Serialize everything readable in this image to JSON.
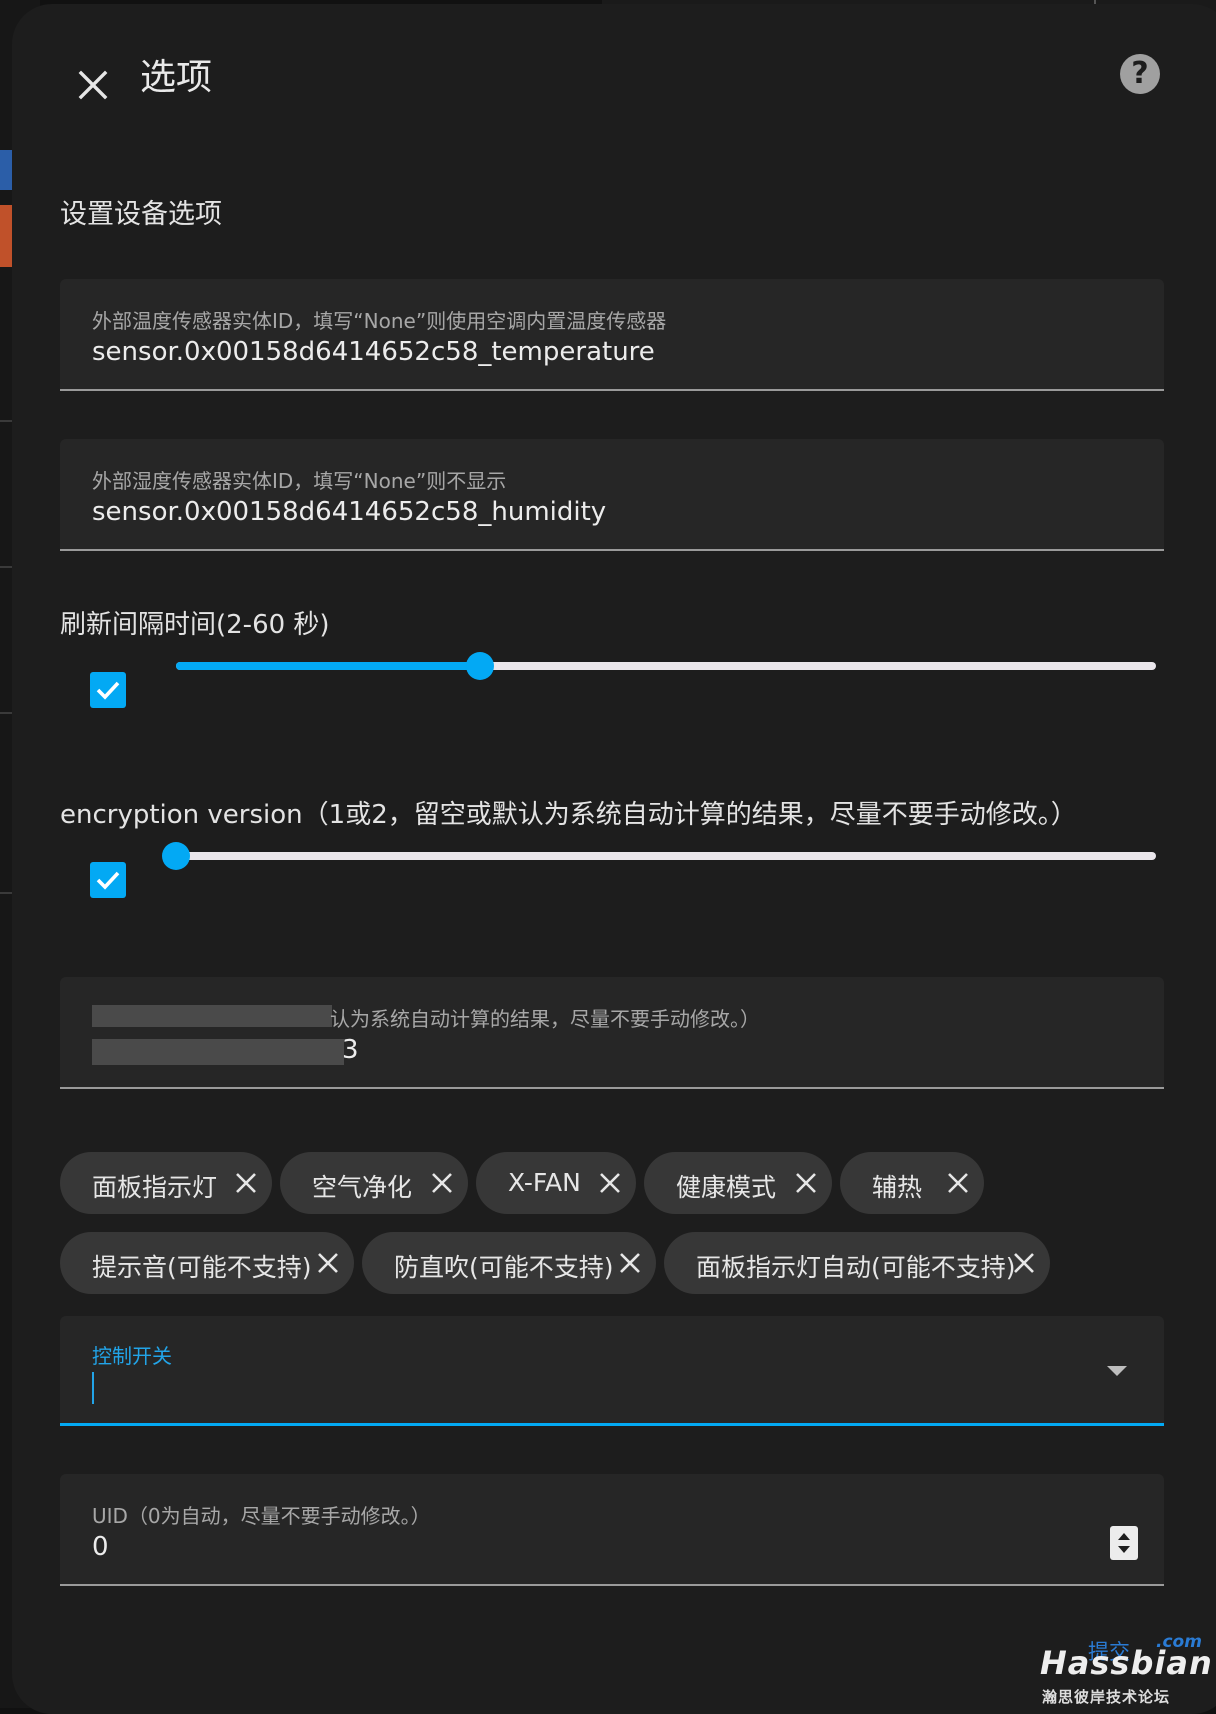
{
  "dialog": {
    "title": "选项",
    "help_label": "?",
    "section_title": "设置设备选项"
  },
  "fields": {
    "temp_sensor": {
      "label": "外部温度传感器实体ID，填写“None”则使用空调内置温度传感器",
      "value": "sensor.0x00158d6414652c58_temperature"
    },
    "humidity_sensor": {
      "label": "外部湿度传感器实体ID，填写“None”则不显示",
      "value": "sensor.0x00158d6414652c58_humidity"
    },
    "blurred_field": {
      "label_visible": "认为系统自动计算的结果，尽量不要手动修改。）",
      "value_visible": "3"
    }
  },
  "sliders": {
    "refresh": {
      "label": "刷新间隔时间(2-60 秒)",
      "enabled": true,
      "value_fraction": 0.31
    },
    "encryption": {
      "label": "encryption version（1或2，留空或默认为系统自动计算的结果，尽量不要手动修改。）",
      "enabled": true,
      "value_fraction": 0.0
    }
  },
  "chips": [
    "面板指示灯",
    "空气净化",
    "X-FAN",
    "健康模式",
    "辅热",
    "提示音(可能不支持)",
    "防直吹(可能不支持)",
    "面板指示灯自动(可能不支持)"
  ],
  "control_switch": {
    "label": "控制开关",
    "value": ""
  },
  "uid": {
    "label": "UID（0为自动，尽量不要手动修改。）",
    "value": "0"
  },
  "watermark": {
    "submit": "提交",
    "com": ".com",
    "brand": "Hassbian",
    "sub": "瀚思彼岸技术论坛"
  },
  "colors": {
    "accent": "#03a9f4",
    "dialog_bg": "#1d1d1d",
    "field_bg": "#262626",
    "chip_bg": "#373737"
  },
  "icons": [
    "close-icon",
    "help-icon",
    "checkbox-check-icon",
    "chip-close-icon",
    "dropdown-arrow-icon",
    "spinner-icon"
  ]
}
